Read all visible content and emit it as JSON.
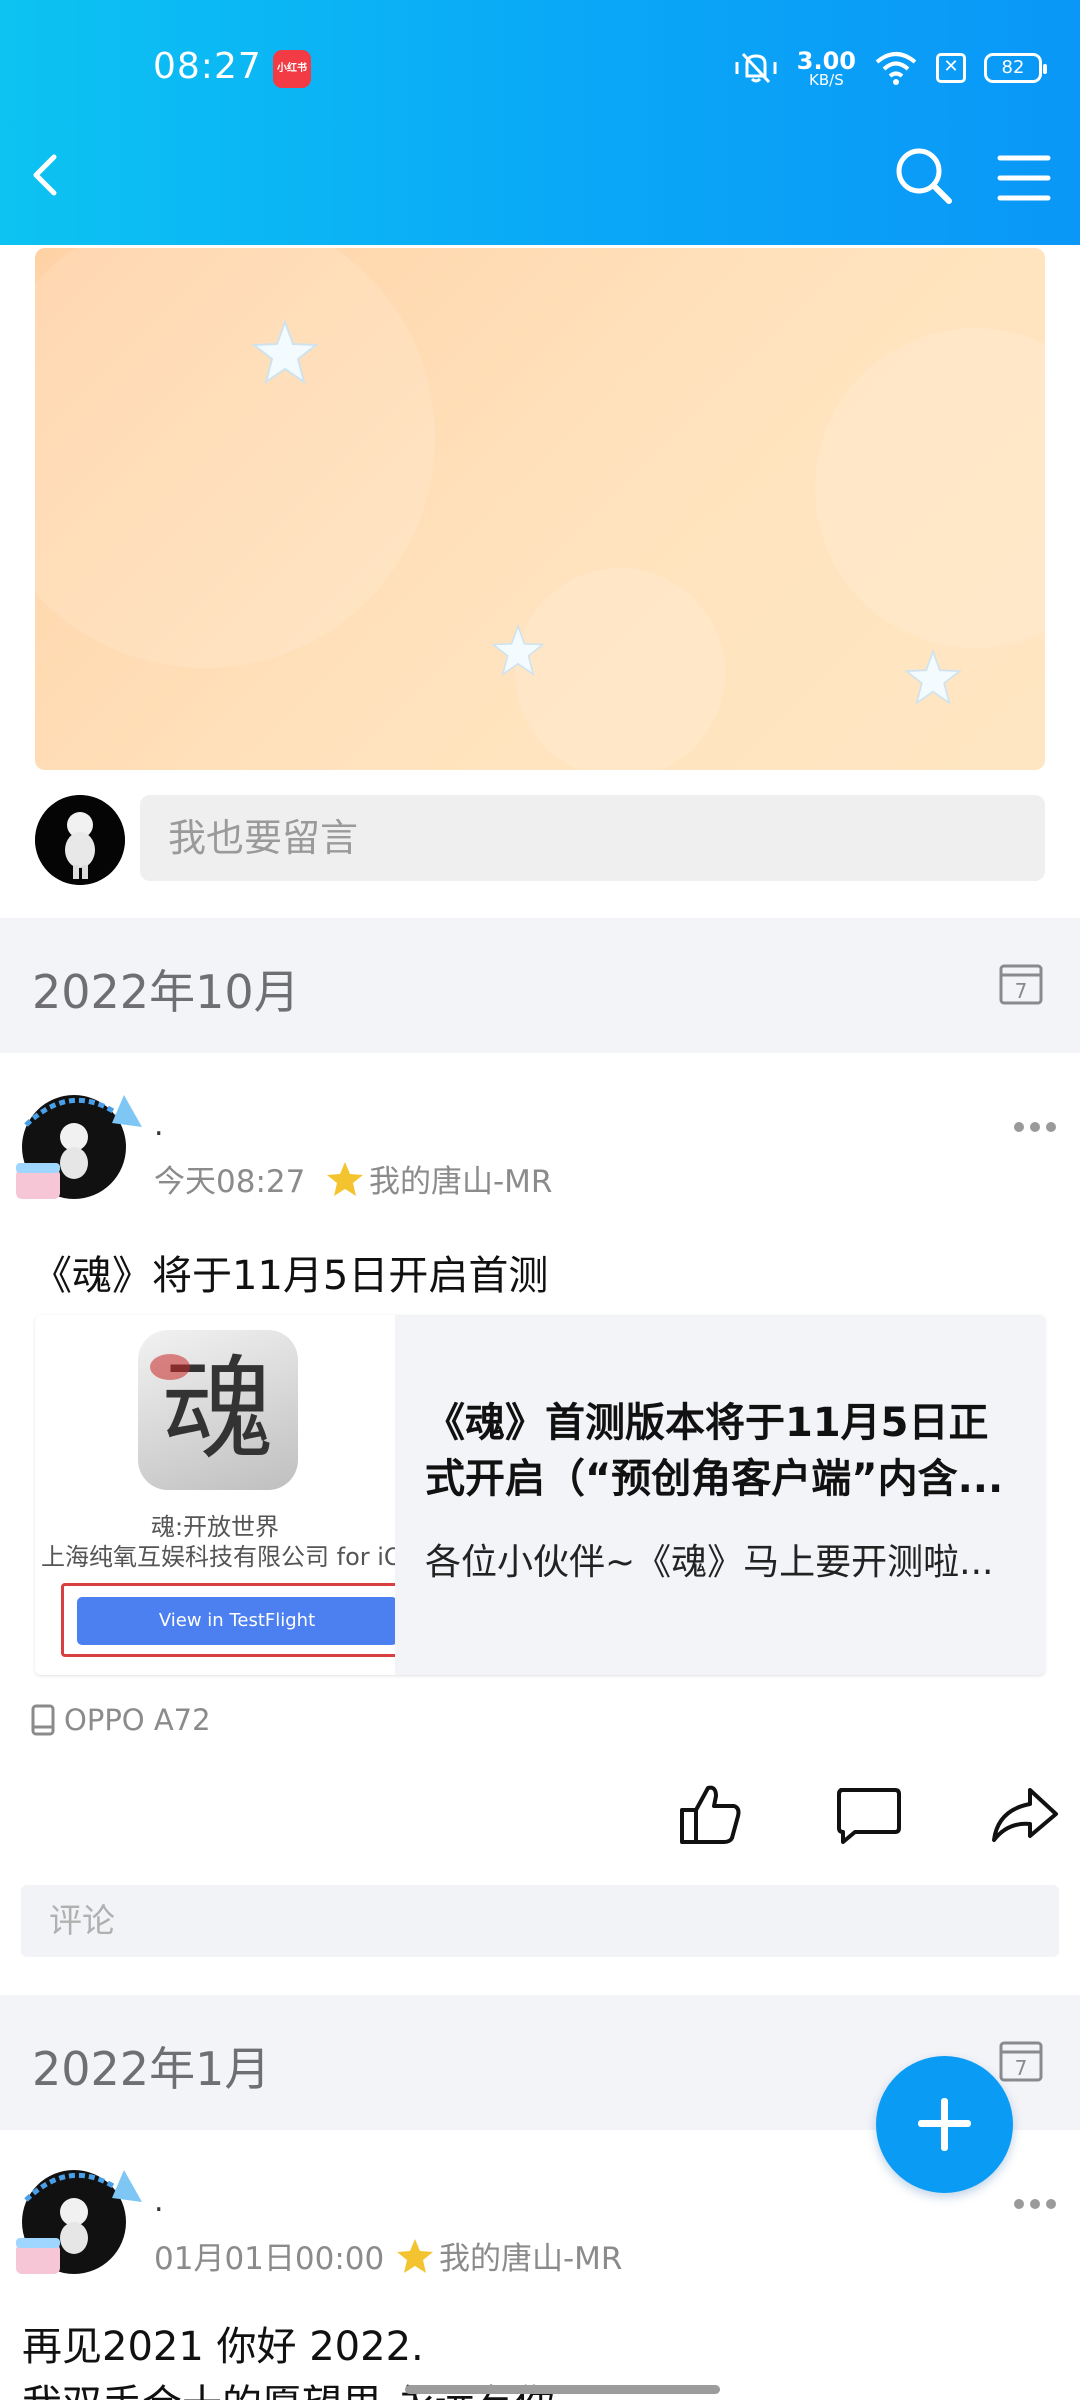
{
  "status_bar": {
    "time": "08:27",
    "app_badge": "小红书",
    "net_speed_value": "3.00",
    "net_speed_unit": "KB/S",
    "battery": "82"
  },
  "nav": {
    "back_icon": "chevron-left-icon",
    "search_icon": "search-icon",
    "menu_icon": "menu-icon"
  },
  "guestbook": {
    "placeholder": "我也要留言"
  },
  "timeline": [
    {
      "month": "2022年10月",
      "post": {
        "author": ".",
        "time": "今天08:27",
        "group": "我的唐山-MR",
        "title": "《魂》将于11月5日开启首测",
        "link_card": {
          "thumb_glyph": "魂",
          "thumb_title": "魂:开放世界",
          "thumb_developer": "上海纯氧互娱科技有限公司 for iOS",
          "thumb_button": "View in TestFlight",
          "title": "《魂》首测版本将于11月5日正式开启（“预创角客户端”内含...",
          "description": "各位小伙伴~《魂》马上要开测啦..."
        },
        "device": "OPPO A72",
        "comment_placeholder": "评论"
      }
    },
    {
      "month": "2022年1月",
      "post": {
        "author": ".",
        "time": "01月01日00:00",
        "group": "我的唐山-MR",
        "text_line1": "再见2021 你好 2022.",
        "text_line2": "我双手合十的愿望里 永远有你"
      }
    }
  ],
  "colors": {
    "header_start": "#0cc3f2",
    "header_end": "#0a97f7",
    "fab": "#0a9bf5",
    "month_bg": "#f3f4f8",
    "banner": "#ffdcb5"
  }
}
